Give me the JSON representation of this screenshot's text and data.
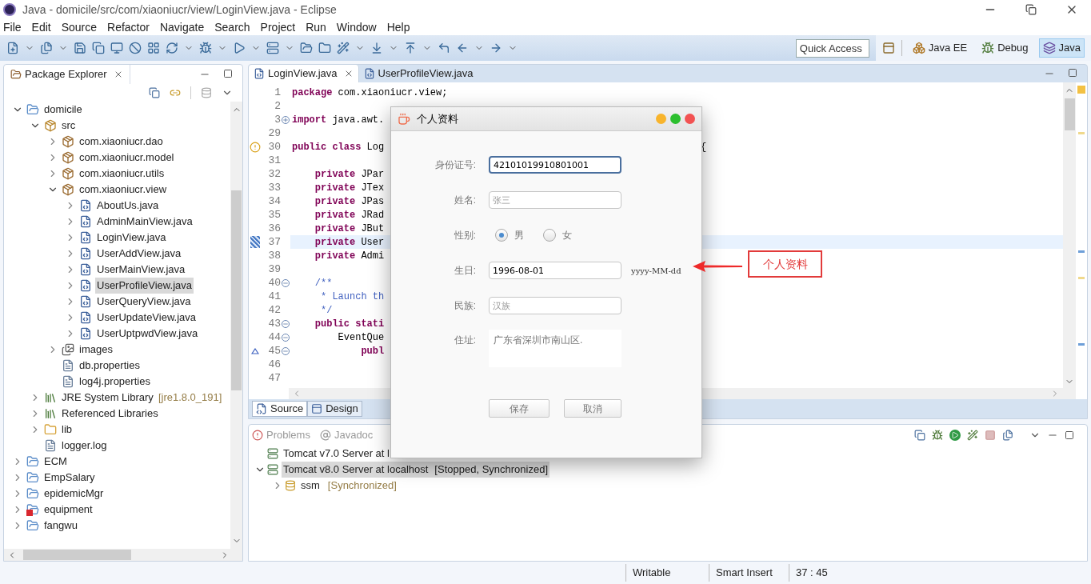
{
  "window": {
    "title": "Java - domicile/src/com/xiaoniucr/view/LoginView.java - Eclipse"
  },
  "menu": [
    "File",
    "Edit",
    "Source",
    "Refactor",
    "Navigate",
    "Search",
    "Project",
    "Run",
    "Window",
    "Help"
  ],
  "quick_access": {
    "placeholder": "Quick Access"
  },
  "perspectives": [
    {
      "label": "Java EE",
      "kind": "javaee",
      "selected": false
    },
    {
      "label": "Debug",
      "kind": "debug",
      "selected": false
    },
    {
      "label": "Java",
      "kind": "java",
      "selected": true
    }
  ],
  "explorer": {
    "title": "Package Explorer",
    "items": [
      {
        "label": "domicile",
        "kind": "project",
        "expanded": true,
        "selected": false,
        "children": [
          {
            "label": "src",
            "kind": "source",
            "expanded": true,
            "selected": false,
            "children": [
              {
                "label": "com.xiaoniucr.dao",
                "kind": "package",
                "expanded": false,
                "selected": false
              },
              {
                "label": "com.xiaoniucr.model",
                "kind": "package",
                "expanded": false,
                "selected": false
              },
              {
                "label": "com.xiaoniucr.utils",
                "kind": "package",
                "expanded": false,
                "selected": false
              },
              {
                "label": "com.xiaoniucr.view",
                "kind": "package",
                "expanded": true,
                "selected": false,
                "children": [
                  {
                    "label": "AboutUs.java",
                    "kind": "java",
                    "expanded": false,
                    "selected": false
                  },
                  {
                    "label": "AdminMainView.java",
                    "kind": "java",
                    "expanded": false,
                    "selected": false
                  },
                  {
                    "label": "LoginView.java",
                    "kind": "java",
                    "expanded": false,
                    "selected": false
                  },
                  {
                    "label": "UserAddView.java",
                    "kind": "java",
                    "expanded": false,
                    "selected": false
                  },
                  {
                    "label": "UserMainView.java",
                    "kind": "java",
                    "expanded": false,
                    "selected": false
                  },
                  {
                    "label": "UserProfileView.java",
                    "kind": "java",
                    "expanded": false,
                    "selected": true
                  },
                  {
                    "label": "UserQueryView.java",
                    "kind": "java",
                    "expanded": false,
                    "selected": false
                  },
                  {
                    "label": "UserUpdateView.java",
                    "kind": "java",
                    "expanded": false,
                    "selected": false
                  },
                  {
                    "label": "UserUptpwdView.java",
                    "kind": "java",
                    "expanded": false,
                    "selected": false
                  }
                ]
              },
              {
                "label": "images",
                "kind": "images",
                "expanded": false,
                "selected": false
              },
              {
                "label": "db.properties",
                "kind": "file",
                "selected": false
              },
              {
                "label": "log4j.properties",
                "kind": "file",
                "selected": false
              }
            ]
          },
          {
            "label": "JRE System Library",
            "decoration": "[jre1.8.0_191]",
            "kind": "library",
            "expanded": false,
            "selected": false
          },
          {
            "label": "Referenced Libraries",
            "kind": "library",
            "expanded": false,
            "selected": false
          },
          {
            "label": "lib",
            "kind": "folder",
            "expanded": false,
            "selected": false
          },
          {
            "label": "logger.log",
            "kind": "file",
            "selected": false
          }
        ]
      },
      {
        "label": "ECM",
        "kind": "project",
        "expanded": false,
        "selected": false
      },
      {
        "label": "EmpSalary",
        "kind": "project",
        "expanded": false,
        "selected": false
      },
      {
        "label": "epidemicMgr",
        "kind": "project",
        "expanded": false,
        "selected": false
      },
      {
        "label": "equipment",
        "kind": "project-error",
        "expanded": false,
        "selected": false
      },
      {
        "label": "fangwu",
        "kind": "project",
        "expanded": false,
        "selected": false
      }
    ]
  },
  "editor": {
    "tabs": [
      {
        "label": "LoginView.java",
        "selected": true
      },
      {
        "label": "UserProfileView.java",
        "selected": false
      }
    ],
    "lines": [
      {
        "number": "1",
        "current": false,
        "tokens": [
          {
            "kind": "keyword",
            "text": "package"
          },
          {
            "kind": "plain",
            "text": " com.xiaoniucr.view;"
          }
        ]
      },
      {
        "number": "2",
        "current": false
      },
      {
        "number": "3",
        "current": false,
        "folded": true,
        "tokens": [
          {
            "kind": "keyword",
            "text": "import"
          },
          {
            "kind": "plain",
            "text": " java.awt."
          }
        ]
      },
      {
        "number": "29",
        "current": false
      },
      {
        "number": "30",
        "current": false,
        "warning": true,
        "tokens": [
          {
            "kind": "keyword",
            "text": "public class"
          },
          {
            "kind": "plain",
            "text": " Log"
          }
        ],
        "tail": "{"
      },
      {
        "number": "31",
        "current": false
      },
      {
        "number": "32",
        "current": false,
        "tokens": [
          {
            "kind": "keyword",
            "text": "    private"
          },
          {
            "kind": "plain",
            "text": " JPar"
          }
        ]
      },
      {
        "number": "33",
        "current": false,
        "tokens": [
          {
            "kind": "keyword",
            "text": "    private"
          },
          {
            "kind": "plain",
            "text": " JTex"
          }
        ]
      },
      {
        "number": "34",
        "current": false,
        "tokens": [
          {
            "kind": "keyword",
            "text": "    private"
          },
          {
            "kind": "plain",
            "text": " JPas"
          }
        ]
      },
      {
        "number": "35",
        "current": false,
        "tokens": [
          {
            "kind": "keyword",
            "text": "    private"
          },
          {
            "kind": "plain",
            "text": " JRad"
          }
        ]
      },
      {
        "number": "36",
        "current": false,
        "tokens": [
          {
            "kind": "keyword",
            "text": "    private"
          },
          {
            "kind": "plain",
            "text": " JBut"
          }
        ]
      },
      {
        "number": "37",
        "current": true,
        "tokens": [
          {
            "kind": "keyword",
            "text": "    private"
          },
          {
            "kind": "plain",
            "text": " User"
          }
        ]
      },
      {
        "number": "38",
        "current": false,
        "tokens": [
          {
            "kind": "keyword",
            "text": "    private"
          },
          {
            "kind": "plain",
            "text": " Admi"
          }
        ]
      },
      {
        "number": "39",
        "current": false
      },
      {
        "number": "40",
        "current": false,
        "folded": false,
        "tokens": [
          {
            "kind": "comment",
            "text": "    /**"
          }
        ]
      },
      {
        "number": "41",
        "current": false,
        "tokens": [
          {
            "kind": "comment",
            "text": "     * Launch th"
          }
        ]
      },
      {
        "number": "42",
        "current": false,
        "tokens": [
          {
            "kind": "comment",
            "text": "     */"
          }
        ]
      },
      {
        "number": "43",
        "current": false,
        "folded": false,
        "tokens": [
          {
            "kind": "keyword",
            "text": "    public stati"
          }
        ]
      },
      {
        "number": "44",
        "current": false,
        "folded": false,
        "tokens": [
          {
            "kind": "plain",
            "text": "        EventQue"
          }
        ]
      },
      {
        "number": "45",
        "current": false,
        "folded": false,
        "override": true,
        "tokens": [
          {
            "kind": "keyword",
            "text": "            publ"
          }
        ]
      },
      {
        "number": "46",
        "current": false
      },
      {
        "number": "47",
        "current": false
      }
    ],
    "bottom_tabs": [
      {
        "label": "Source",
        "kind": "source",
        "selected": true
      },
      {
        "label": "Design",
        "kind": "design",
        "selected": false
      }
    ]
  },
  "servers": {
    "tabs": [
      {
        "label": "Problems",
        "kind": "problems"
      },
      {
        "label": "Javadoc",
        "kind": "javadoc"
      }
    ],
    "items": [
      {
        "label": "Tomcat v7.0 Server at l",
        "selected": false
      },
      {
        "label": "Tomcat v8.0 Server at localhost",
        "status": "[Stopped, Synchronized]",
        "expanded": true,
        "selected": true,
        "children": [
          {
            "label": "ssm",
            "status": "[Synchronized]",
            "expanded": false,
            "selected": false
          }
        ]
      }
    ]
  },
  "status_bar": [
    "Writable",
    "Smart Insert",
    "37 : 45"
  ],
  "dialog": {
    "title": "个人资料",
    "lights": [
      {
        "color": "#f8b42c"
      },
      {
        "color": "#2cbf2e"
      },
      {
        "color": "#f25252"
      }
    ],
    "fields": [
      {
        "kind": "text",
        "label": "身份证号:",
        "value": "42101019910801001",
        "focused": true,
        "disabled": false
      },
      {
        "kind": "text",
        "label": "姓名:",
        "value": "张三",
        "focused": false,
        "disabled": true
      },
      {
        "kind": "radio",
        "label": "性别:",
        "options": [
          {
            "label": "男",
            "selected": true
          },
          {
            "label": "女",
            "selected": false
          }
        ]
      },
      {
        "kind": "text",
        "label": "生日:",
        "value": "1996-08-01",
        "hint": "yyyy-MM-dd",
        "focused": false,
        "disabled": false
      },
      {
        "kind": "text",
        "label": "民族:",
        "value": "汉族",
        "focused": false,
        "disabled": true
      },
      {
        "kind": "textarea",
        "label": "住址:",
        "value": "广东省深圳市南山区."
      }
    ],
    "buttons": [
      "保存",
      "取消"
    ]
  },
  "annotation": {
    "label": "个人资料"
  }
}
